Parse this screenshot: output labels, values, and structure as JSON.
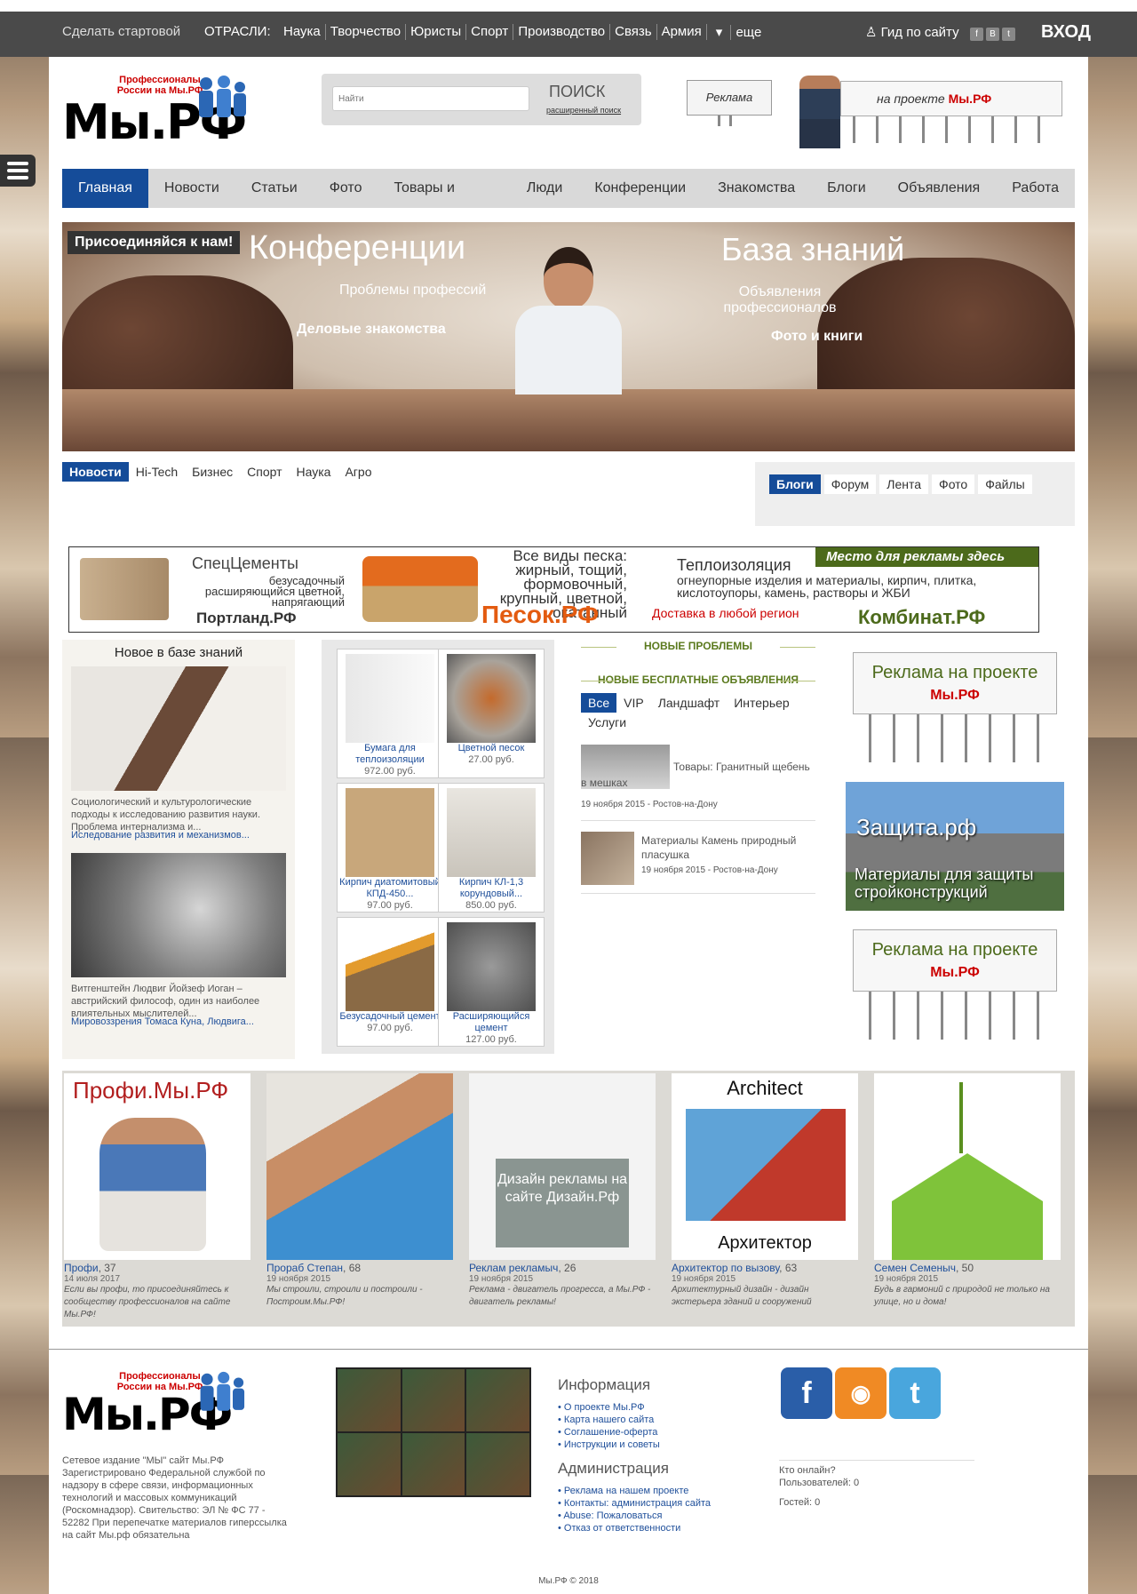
{
  "topbar": {
    "start": "Сделать стартовой",
    "industries_label": "ОТРАСЛИ:",
    "industries": [
      "Наука",
      "Творчество",
      "Юристы",
      "Спорт",
      "Производство",
      "Связь",
      "Армия"
    ],
    "more": "еще",
    "guide": "Гид по сайту",
    "social": [
      "f",
      "B",
      "t"
    ],
    "login": "ВХОД"
  },
  "logo": {
    "slogan": "Профессионалы России на Мы.РФ",
    "word": "Мы.РФ"
  },
  "search": {
    "placeholder": "Найти",
    "button": "ПОИСК",
    "advanced": "расширенный поиск"
  },
  "ads_header": {
    "billboard": "Реклама",
    "project_text": "на проекте",
    "project_brand": "Мы.РФ"
  },
  "nav": {
    "items": [
      "Главная",
      "Новости",
      "Статьи",
      "Фото",
      "Товары и услуги",
      "Люди",
      "Конференции",
      "Знакомства",
      "Блоги",
      "Объявления",
      "Работа"
    ]
  },
  "hero": {
    "join": "Присоединяйся к нам!",
    "conf": "Конференции",
    "problems": "Проблемы профессий",
    "dating": "Деловые знакомства",
    "kb": "База знаний",
    "ads": "Объявления профессионалов",
    "photo": "Фото и книги"
  },
  "news_tabs": [
    "Новости",
    "Hi-Tech",
    "Бизнес",
    "Спорт",
    "Наука",
    "Агро"
  ],
  "blog_tabs": [
    "Блоги",
    "Форум",
    "Лента",
    "Фото",
    "Файлы"
  ],
  "banner": {
    "cement_title": "СпецЦементы",
    "cement_text": "безусадочный расширяющийся цветной, напрягающий",
    "cement_brand": "Портланд.РФ",
    "sand_title": "Все виды песка: жирный, тощий, формовочный, крупный, цветной, окатанный",
    "sand_brand": "Песок.РФ",
    "insul_title": "Теплоизоляция",
    "insul_text": "огнеупорные изделия и материалы, кирпич, плитка, кислотоупоры, камень, растворы и ЖБИ",
    "delivery": "Доставка в любой регион",
    "kombinat": "Комбинат.РФ",
    "place": "Место для рекламы здесь"
  },
  "kb": {
    "title": "Новое в базе знаний",
    "items": [
      {
        "text": "Социологический и культурологические подходы к исследованию развития науки. Проблема интернализма и...",
        "link": "Иследование развития и механизмов..."
      },
      {
        "text": "Витгенштейн Людвиг Йойзеф Иоган – австрийский философ, один из наиболее влиятельных мыслителей...",
        "link": "Мировоззрения Томаса Куна, Людвига..."
      }
    ]
  },
  "products": [
    {
      "title": "Бумага для теплоизоляции",
      "price": "972.00 руб."
    },
    {
      "title": "Цветной песок",
      "price": "27.00 руб."
    },
    {
      "title": "Кирпич диатомитовый КПД-450...",
      "price": "97.00 руб."
    },
    {
      "title": "Кирпич КЛ-1,3 корундовый...",
      "price": "850.00 руб."
    },
    {
      "title": "Безусадочный цемент",
      "price": "97.00 руб."
    },
    {
      "title": "Расширяющийся цемент",
      "price": "127.00 руб."
    }
  ],
  "mid": {
    "problems": "НОВЫЕ ПРОБЛЕМЫ",
    "free_ads": "НОВЫЕ БЕСПЛАТНЫЕ ОБЪЯВЛЕНИЯ",
    "tabs": [
      "Все",
      "VIP",
      "Ландшафт",
      "Интерьер",
      "Услуги"
    ],
    "items": [
      {
        "title": "Товары: Гранитный щебень в мешках",
        "meta": "19 ноября 2015 - Ростов-на-Дону"
      },
      {
        "title": "Материалы Камень природный пласушка",
        "meta": "19 ноября 2015 - Ростов-на-Дону"
      }
    ]
  },
  "right_ads": {
    "project": "Реклама на проекте",
    "brand": "Мы.РФ",
    "zashita": "Защита.рф",
    "zashita_text": "Материалы для защиты стройконструкций"
  },
  "gallery": [
    {
      "img_title": "Профи.Мы.РФ",
      "name": "Профи",
      "count": "37",
      "date": "14 июля 2017",
      "quote": "Если вы профи, то присоединяйтесь к сообществу профессионалов на сайте Мы.РФ!"
    },
    {
      "img_title": "",
      "name": "Прораб Степан",
      "count": "68",
      "date": "19 ноября 2015",
      "quote": "Мы строили, строили и построили - Построим.Мы.РФ!"
    },
    {
      "img_title": "Дизайн рекламы на сайте Дизайн.Рф",
      "name": "Реклам рекламыч",
      "count": "26",
      "date": "19 ноября 2015",
      "quote": "Реклама - двигатель прогресса, а Мы.РФ - двигатель рекламы!"
    },
    {
      "img_title": "Architect",
      "img_sub": "Архитектор",
      "name": "Архитектор по вызову",
      "count": "63",
      "date": "19 ноября 2015",
      "quote": "Архитектурный дизайн - дизайн экстерьера зданий и сооружений"
    },
    {
      "img_title": "",
      "name": "Семен Семеныч",
      "count": "50",
      "date": "19 ноября 2015",
      "quote": "Будь в гармоний с природой не только на улице, но и дома!"
    }
  ],
  "footer": {
    "about": "Сетевое издание \"МЫ\" сайт Мы.РФ Зарегистрировано Федеральной службой по надзору в сфере связи, информационных технологий и массовых коммуникаций (Роскомнадзор). Свительство: ЭЛ № ФС 77 - 52282 При перепечатке материалов гиперссылка на сайт Мы.рф обязательна",
    "info_title": "Информация",
    "info_links": [
      "О проекте Мы.РФ",
      "Карта нашего сайта",
      "Соглашение-оферта",
      "Инструкции и советы"
    ],
    "admin_title": "Администрация",
    "admin_links": [
      "Реклама на нашем проекте",
      "Контакты: администрация сайта",
      "Abuse: Пожаловаться",
      "Отказ от ответственности"
    ],
    "online": "Кто онлайн?",
    "users": "Пользователей: 0",
    "guests": "Гостей: 0",
    "copyright": "Мы.РФ © 2018"
  }
}
